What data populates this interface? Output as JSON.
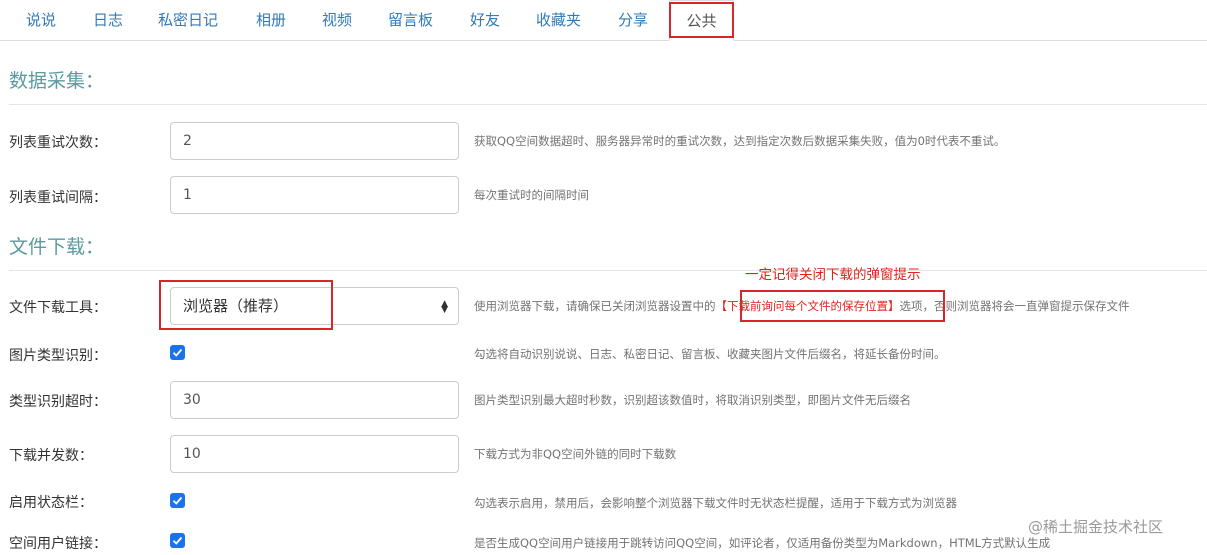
{
  "tabs": [
    {
      "label": "说说"
    },
    {
      "label": "日志"
    },
    {
      "label": "私密日记"
    },
    {
      "label": "相册"
    },
    {
      "label": "视频"
    },
    {
      "label": "留言板"
    },
    {
      "label": "好友"
    },
    {
      "label": "收藏夹"
    },
    {
      "label": "分享"
    },
    {
      "label": "公共",
      "active": true
    }
  ],
  "sections": {
    "data_collection": {
      "title": "数据采集："
    },
    "file_download": {
      "title": "文件下载："
    }
  },
  "fields": {
    "list_retry_count": {
      "label": "列表重试次数：",
      "value": "2",
      "help": "获取QQ空间数据超时、服务器异常时的重试次数，达到指定次数后数据采集失败，值为0时代表不重试。"
    },
    "list_retry_interval": {
      "label": "列表重试间隔：",
      "value": "1",
      "help": "每次重试时的间隔时间"
    },
    "download_tool": {
      "label": "文件下载工具：",
      "value": "浏览器（推荐）",
      "help_before": "使用浏览器下载，请确保已关闭浏览器设置中的",
      "help_highlight": "【下载前询问每个文件的保存位置】",
      "help_after": "选项，否则浏览器将会一直弹窗提示保存文件",
      "annotation": "一定记得关闭下载的弹窗提示"
    },
    "image_type_detect": {
      "label": "图片类型识别：",
      "checked": true,
      "help": "勾选将自动识别说说、日志、私密日记、留言板、收藏夹图片文件后缀名，将延长备份时间。"
    },
    "type_detect_timeout": {
      "label": "类型识别超时：",
      "value": "30",
      "help": "图片类型识别最大超时秒数，识别超该数值时，将取消识别类型，即图片文件无后缀名"
    },
    "download_concurrency": {
      "label": "下载并发数：",
      "value": "10",
      "help": "下载方式为非QQ空间外链的同时下载数"
    },
    "enable_status_bar": {
      "label": "启用状态栏：",
      "checked": true,
      "help": "勾选表示启用，禁用后，会影响整个浏览器下载文件时无状态栏提醒，适用于下载方式为浏览器"
    },
    "space_user_link": {
      "label": "空间用户链接：",
      "checked": true,
      "help": "是否生成QQ空间用户链接用于跳转访问QQ空间，如评论者，仅适用备份类型为Markdown，HTML方式默认生成"
    }
  },
  "watermark": "@稀土掘金技术社区",
  "colors": {
    "tab_link": "#337ab7",
    "section_title": "#5b9aa0",
    "annotation_red": "#e3221c",
    "checkbox": "#1a73e8"
  }
}
